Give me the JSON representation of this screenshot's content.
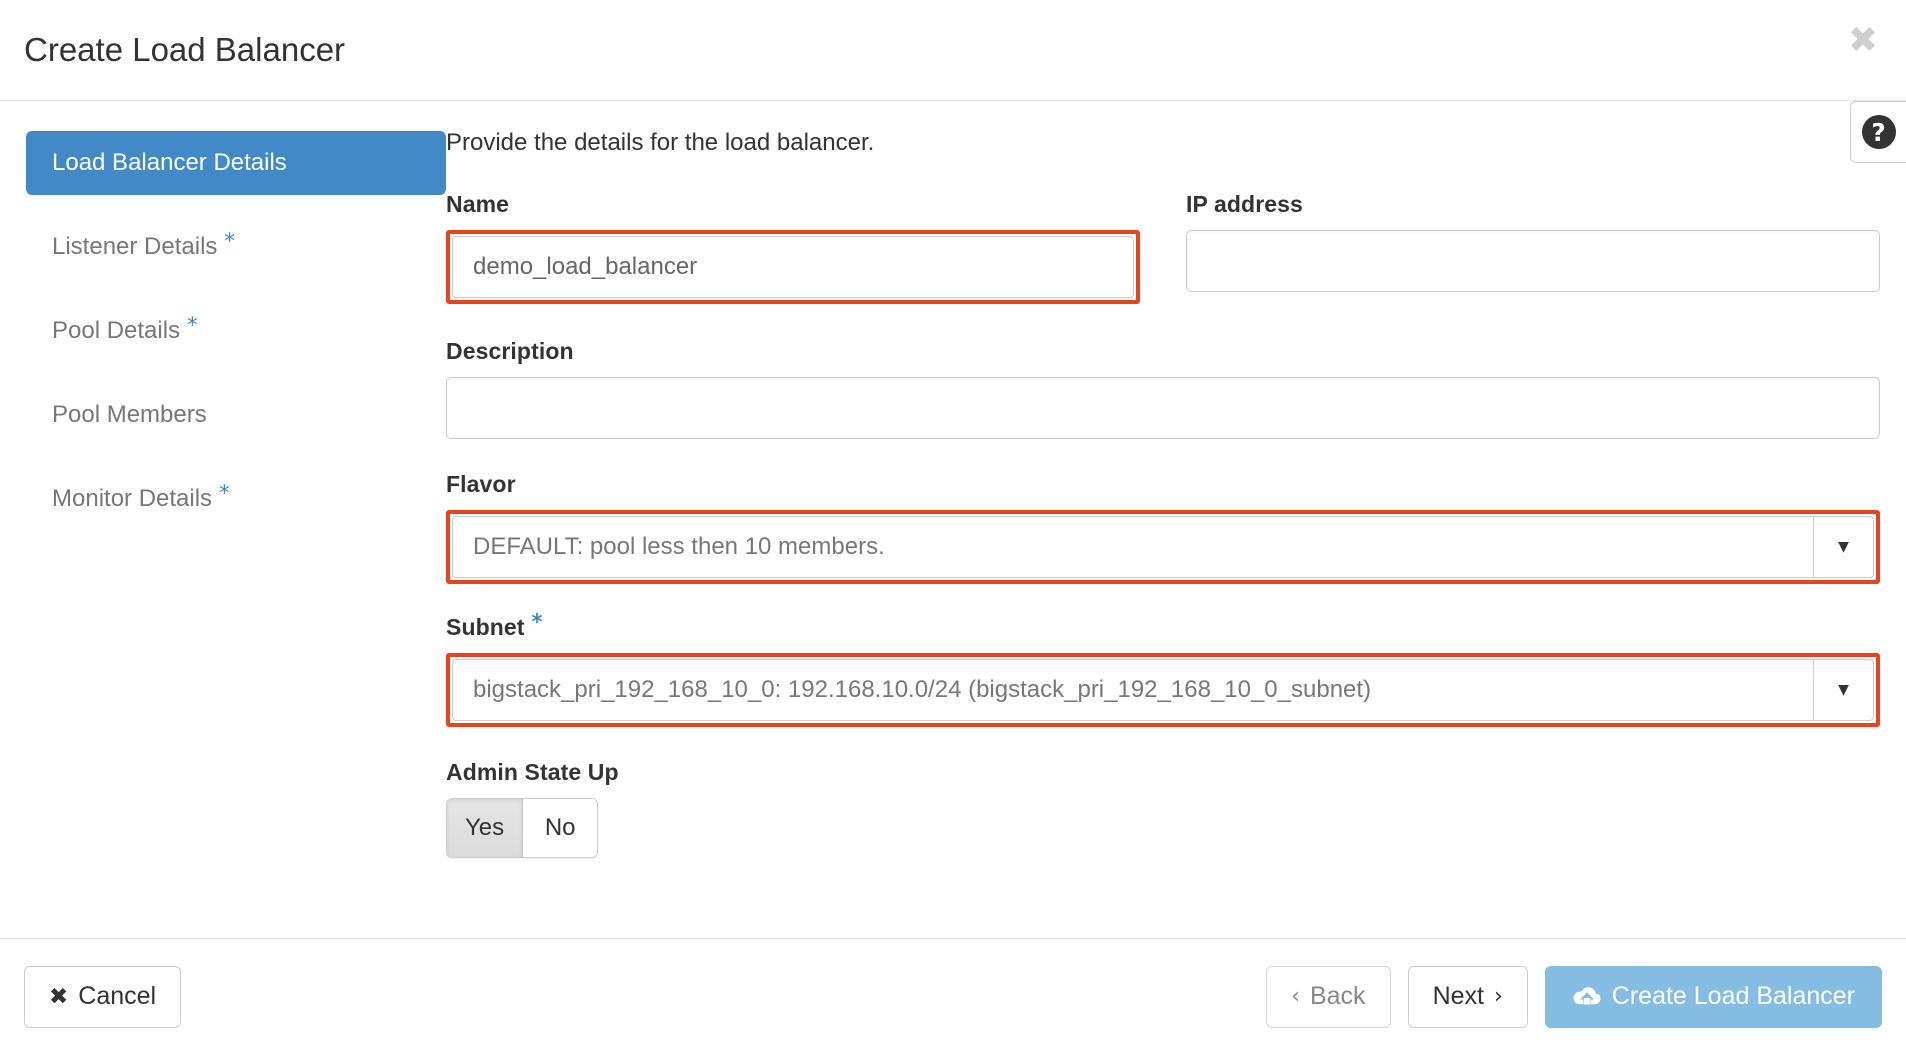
{
  "header": {
    "title": "Create Load Balancer",
    "close_icon": "close-icon"
  },
  "help": {
    "glyph": "?"
  },
  "sidebar": {
    "items": [
      {
        "label": "Load Balancer Details",
        "required": false,
        "active": true
      },
      {
        "label": "Listener Details",
        "required": true,
        "active": false
      },
      {
        "label": "Pool Details",
        "required": true,
        "active": false
      },
      {
        "label": "Pool Members",
        "required": false,
        "active": false
      },
      {
        "label": "Monitor Details",
        "required": true,
        "active": false
      }
    ],
    "required_marker": "*"
  },
  "main": {
    "intro": "Provide the details for the load balancer.",
    "fields": {
      "name": {
        "label": "Name",
        "value": "demo_load_balancer",
        "placeholder": "",
        "highlighted": true
      },
      "ip_address": {
        "label": "IP address",
        "value": "",
        "placeholder": "",
        "highlighted": false
      },
      "description": {
        "label": "Description",
        "value": "",
        "placeholder": "",
        "highlighted": false
      },
      "flavor": {
        "label": "Flavor",
        "value": "DEFAULT: pool less then 10 members.",
        "caret_icon": "chevron-down-icon",
        "highlighted": true
      },
      "subnet": {
        "label": "Subnet",
        "required_marker": "*",
        "value": "bigstack_pri_192_168_10_0: 192.168.10.0/24 (bigstack_pri_192_168_10_0_subnet)",
        "caret_icon": "chevron-down-icon",
        "highlighted": true
      },
      "admin_state_up": {
        "label": "Admin State Up",
        "options": [
          "Yes",
          "No"
        ],
        "selected": "Yes"
      }
    }
  },
  "footer": {
    "cancel": {
      "label": "Cancel",
      "icon": "close-icon"
    },
    "back": {
      "label": "Back",
      "icon": "chevron-left-icon"
    },
    "next": {
      "label": "Next",
      "icon": "chevron-right-icon"
    },
    "submit": {
      "label": "Create Load Balancer",
      "icon": "cloud-download-icon"
    }
  },
  "colors": {
    "accent_blue": "#4189c7",
    "primary_button": "#85bce2",
    "highlight_red": "#e8431f",
    "star_blue": "#3c87c4"
  }
}
